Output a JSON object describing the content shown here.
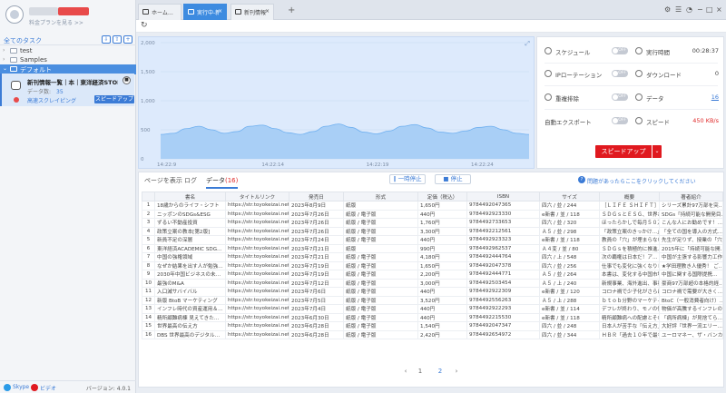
{
  "sidebar": {
    "plan_link": "料金プランを見る >>",
    "task_header": "全てのタスク",
    "tree": [
      {
        "label": "test"
      },
      {
        "label": "Samples"
      },
      {
        "label": "デフォルト"
      }
    ],
    "task": {
      "title": "新刊情報一覧｜本｜東洋経済STORE-スク…",
      "meta_label": "データ数:",
      "meta_count": "35",
      "run_mode": "高速スクレイピング",
      "speed_up": "スピードアップ"
    },
    "footer": {
      "skype": "Skype",
      "video": "ビデオ",
      "version": "バージョン: 4.0.1"
    }
  },
  "tabs": [
    {
      "label": "ホーム…",
      "active": false
    },
    {
      "label": "実行中-新…",
      "active": true
    },
    {
      "label": "新刊情報…",
      "active": false
    }
  ],
  "chart_data": {
    "type": "area",
    "y_ticks": [
      "2,000",
      "1,500",
      "1,000",
      "500",
      "0"
    ],
    "x_ticks": [
      "14:22:9",
      "14:22:14",
      "14:22:19",
      "14:22:24"
    ],
    "ylim": [
      0,
      2000
    ],
    "values": [
      420,
      440,
      520,
      560,
      500,
      440,
      470,
      560,
      580,
      520,
      450,
      420,
      470,
      560,
      600,
      540,
      460,
      430,
      480,
      560,
      590,
      530,
      460,
      440,
      480,
      540,
      560,
      500,
      440,
      420
    ]
  },
  "status": {
    "schedule": "スケジュール",
    "ip_rotation": "IPローテーション",
    "dedupe": "重複排除",
    "auto_export": "自動エクスポート",
    "toggle_off": "OFF",
    "run_time_label": "実行時間",
    "run_time": "00:28:37",
    "download_label": "ダウンロード",
    "download": "0",
    "data_label": "データ",
    "data": "16",
    "speed_label": "スピード",
    "speed": "450 KB/s",
    "speed_up": "スピードアップ"
  },
  "data_area": {
    "tab_page": "ページを表示",
    "tab_log": "ログ",
    "tab_data": "データ",
    "tab_data_count": "(16)",
    "pause": "一時停止",
    "stop": "停止",
    "help": "問題があったらここをクリックしてください",
    "columns": [
      "",
      "書名",
      "タイトルリンク",
      "発売日",
      "形式",
      "定価（税込）",
      "ISBN",
      "サイズ",
      "概要",
      "著者紹介"
    ],
    "rows": [
      [
        "1",
        "18歳からのライフ・シフト",
        "https://str.toyokeizai.net/bo…",
        "2023年8月9日",
        "紙版",
        "1,650円",
        "9784492047365",
        "四六 / 並 / 244",
        "［ＬＩＦＥ ＳＨＩＦＴ］",
        "シリーズ累計97万部を突…"
      ],
      [
        "2",
        "ニッポンのSDGs&ESG",
        "https://str.toyokeizai.net/bo…",
        "2023年7月26日",
        "紙版 / 電子版",
        "440円",
        "9784492923330",
        "e新書 / 並 / 118",
        "ＳＤＧｓとＥＳＧ、世界が…",
        "SDGs「持続可能な開発目…"
      ],
      [
        "3",
        "ずるい不動産投資",
        "https://str.toyokeizai.net/bo…",
        "2023年7月26日",
        "紙版 / 電子版",
        "1,760円",
        "9784492733653",
        "四六 / 並 / 320",
        "ほったらかしで毎月５０万…",
        "こんな人にお勧めです！…"
      ],
      [
        "4",
        "政策立案の教本[第2版]",
        "https://str.toyokeizai.net/bo…",
        "2023年7月26日",
        "紙版 / 電子版",
        "3,300円",
        "9784492212561",
        "Ａ５ / 並 / 298",
        "「政策立案のきっかけ…」",
        "「全ての国を導入の方式…"
      ],
      [
        "5",
        "新員不足の深層",
        "https://str.toyokeizai.net/bo…",
        "2023年7月24日",
        "紙版 / 電子版",
        "440円",
        "9784492923323",
        "e新書 / 並 / 118",
        "教員の「穴」が埋まらない…",
        "先生が足りず、授業の「穴…"
      ],
      [
        "6",
        "東洋経済ACADEMIC SDG…",
        "https://str.toyokeizai.net/bo…",
        "2023年7月21日",
        "紙版",
        "990円",
        "9784492962537",
        "Ａ４変 / 並 / 80",
        "ＳＤＧｓを積極的に推進…",
        "2015年に「持続可能な開…"
      ],
      [
        "7",
        "中国の強権領域",
        "https://str.toyokeizai.net/bo…",
        "2023年7月21日",
        "紙版 / 電子版",
        "4,180円",
        "9784492444764",
        "四六 / 上 / 548",
        "次の覇権は日本だ！ア…",
        "中国が主張する影響力工作…"
      ],
      [
        "8",
        "なぜか結果を出す人が勉強…",
        "https://str.toyokeizai.net/bo…",
        "2023年7月19日",
        "紙版 / 電子版",
        "1,650円",
        "9784492047378",
        "四六 / 並 / 256",
        "仕事でも変化に強くなりレシ…",
        "★学田理教き人優秀！ ご…"
      ],
      [
        "9",
        "2030年中国ビジネスの未…",
        "https://str.toyokeizai.net/bo…",
        "2023年7月19日",
        "紙版 / 電子版",
        "2,200円",
        "9784492444771",
        "Ａ５ / 並 / 264",
        "本書は、変化する中国市場…",
        "中国に関する国際提携…"
      ],
      [
        "10",
        "最強のM&A",
        "https://str.toyokeizai.net/bo…",
        "2023年7月12日",
        "紙版 / 電子版",
        "3,000円",
        "9784492503454",
        "Ａ５ / 上 / 240",
        "新規事業、海外進出、事業…",
        "豪商97万部超の本格的経…"
      ],
      [
        "11",
        "入口減サバイバル",
        "https://str.toyokeizai.net/bo…",
        "2023年7月6日",
        "紙版 / 電子版",
        "440円",
        "9784492922309",
        "e新書 / 並 / 120",
        "コロナ禍で少子化がさらに…",
        "コロナ禍で需要が大きく…"
      ],
      [
        "12",
        "新版 BtoB マーケティング",
        "https://str.toyokeizai.net/bo…",
        "2023年7月5日",
        "紙版 / 電子版",
        "3,520円",
        "9784492556263",
        "Ａ５ / 上 / 288",
        "ｂｔｏｂ分野のマーケティ…",
        "BtoC（一般消費者向け）…"
      ],
      [
        "13",
        "インフレ時代の資産運用＆…",
        "https://str.toyokeizai.net/bo…",
        "2023年7月4日",
        "紙版 / 電子版",
        "440円",
        "9784492922293",
        "e新書 / 並 / 114",
        "デフレが終わり、モノの値…",
        "物価が高騰するインフレの…"
      ],
      [
        "14",
        "精所顧難病棟 見えてきた…",
        "https://str.toyokeizai.net/bo…",
        "2023年6月30日",
        "紙版 / 電子版",
        "440円",
        "9784492215530",
        "e新書 / 並 / 118",
        "精所顧難病への配慮とその…",
        "「病所病棟」が見捨てら…"
      ],
      [
        "15",
        "世界最高の伝え方",
        "https://str.toyokeizai.net/bo…",
        "2023年6月28日",
        "紙版 / 電子版",
        "1,540円",
        "9784492047347",
        "四六 / 並 / 248",
        "日本人が苦手な「伝え方」…",
        "大好評『世界一流エリー…"
      ],
      [
        "16",
        "DBS 世界最高のデジタル…",
        "https://str.toyokeizai.net/bo…",
        "2023年6月28日",
        "紙版 / 電子版",
        "2,420円",
        "9784492654972",
        "四六 / 並 / 344",
        "ＨＢＲ「過去１０年で最も…",
        "ユーロマネー、ザ・バンカ…"
      ]
    ],
    "pager": [
      "‹",
      "1",
      "2",
      "›"
    ]
  }
}
